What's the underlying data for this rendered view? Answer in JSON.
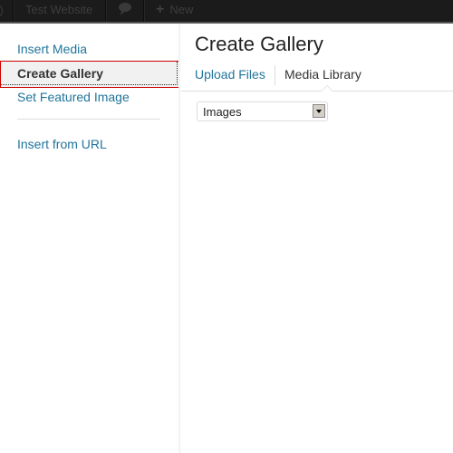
{
  "admin_bar": {
    "site_name": "Test Website",
    "new_label": "New",
    "icons": [
      "wordpress-logo-icon",
      "comment-icon",
      "plus-icon"
    ]
  },
  "sidebar": {
    "items": [
      {
        "label": "Insert Media",
        "active": false
      },
      {
        "label": "Create Gallery",
        "active": true
      },
      {
        "label": "Set Featured Image",
        "active": false
      },
      {
        "label": "Insert from URL",
        "active": false
      }
    ]
  },
  "main": {
    "title": "Create Gallery",
    "tabs": [
      {
        "label": "Upload Files",
        "active": false
      },
      {
        "label": "Media Library",
        "active": true
      }
    ],
    "filter_select": {
      "value": "Images"
    }
  },
  "colors": {
    "link": "#21759b",
    "admin_bar": "#1b1b1b",
    "highlight_border": "#cc0000"
  }
}
